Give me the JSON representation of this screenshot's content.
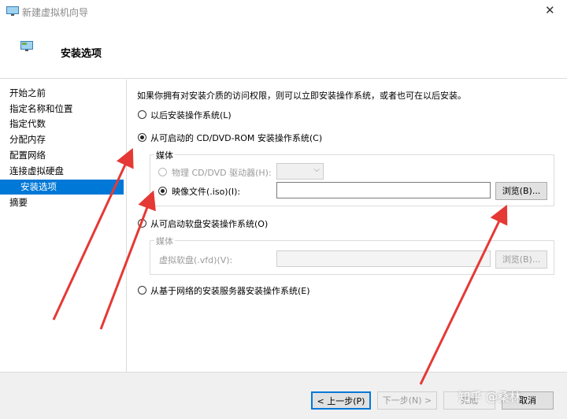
{
  "window": {
    "title": "新建虚拟机向导",
    "close_glyph": "✕"
  },
  "header": {
    "title": "安装选项"
  },
  "sidebar": {
    "items": [
      {
        "label": "开始之前",
        "active": false
      },
      {
        "label": "指定名称和位置",
        "active": false
      },
      {
        "label": "指定代数",
        "active": false
      },
      {
        "label": "分配内存",
        "active": false
      },
      {
        "label": "配置网络",
        "active": false
      },
      {
        "label": "连接虚拟硬盘",
        "active": false
      },
      {
        "label": "安装选项",
        "active": true
      },
      {
        "label": "摘要",
        "active": false
      }
    ]
  },
  "main": {
    "intro": "如果你拥有对安装介质的访问权限，则可以立即安装操作系统，或者也可在以后安装。",
    "options": {
      "later": "以后安装操作系统(L)",
      "cd": "从可启动的 CD/DVD-ROM 安装操作系统(C)",
      "floppy": "从可启动软盘安装操作系统(O)",
      "network": "从基于网络的安装服务器安装操作系统(E)"
    },
    "cd_media": {
      "group_title": "媒体",
      "physical_label": "物理 CD/DVD 驱动器(H):",
      "image_label": "映像文件(.iso)(I):",
      "image_value": "",
      "browse_label": "浏览(B)..."
    },
    "floppy_media": {
      "group_title": "媒体",
      "vfd_label": "虚拟软盘(.vfd)(V):",
      "vfd_value": "",
      "browse_label": "浏览(B)..."
    },
    "selected": "cd"
  },
  "footer": {
    "prev_label": "< 上一步(P)",
    "next_label": "下一步(N) >",
    "finish_label": "完成",
    "cancel_label": "取消"
  },
  "watermark": "知乎 @桑林",
  "colors": {
    "accent": "#0078d7",
    "arrow": "#e53935"
  }
}
